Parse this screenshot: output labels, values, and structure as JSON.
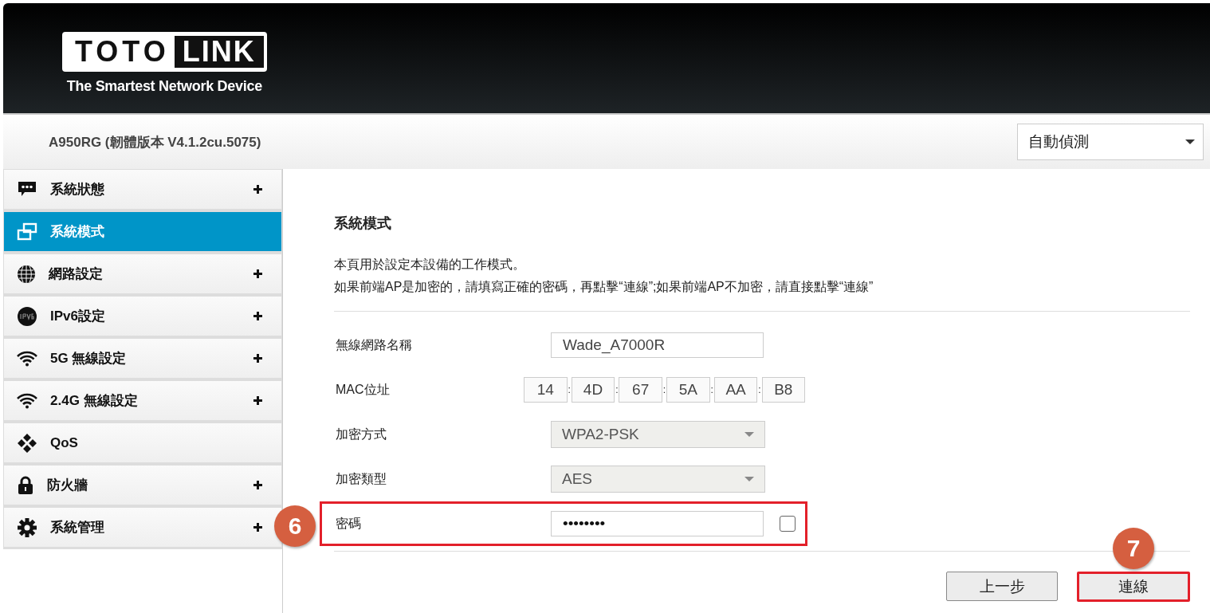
{
  "header": {
    "logo": {
      "left": "TOTO",
      "right": "LINK",
      "tagline": "The Smartest Network Device"
    }
  },
  "subheader": {
    "title": "A950RG (韌體版本 V4.1.2cu.5075)",
    "language": {
      "value": "自動偵測"
    }
  },
  "sidebar": {
    "items": [
      {
        "kind": "chat",
        "label": "系統狀態",
        "expandable": true,
        "selected": false
      },
      {
        "kind": "windows",
        "label": "系統模式",
        "expandable": false,
        "selected": true
      },
      {
        "kind": "globe",
        "label": "網路設定",
        "expandable": true,
        "selected": false
      },
      {
        "kind": "ipv6",
        "label": "IPv6設定",
        "expandable": true,
        "selected": false
      },
      {
        "kind": "wifi",
        "label": "5G 無線設定",
        "expandable": true,
        "selected": false
      },
      {
        "kind": "wifi",
        "label": "2.4G 無線設定",
        "expandable": true,
        "selected": false
      },
      {
        "kind": "qos",
        "label": "QoS",
        "expandable": false,
        "selected": false
      },
      {
        "kind": "lock",
        "label": "防火牆",
        "expandable": true,
        "selected": false
      },
      {
        "kind": "gear",
        "label": "系統管理",
        "expandable": true,
        "selected": false
      }
    ]
  },
  "content": {
    "title": "系統模式",
    "description": [
      "本頁用於設定本設備的工作模式。",
      "如果前端AP是加密的，請填寫正確的密碼，再點擊“連線”;如果前端AP不加密，請直接點擊“連線”"
    ],
    "rows": [
      {
        "kind": "text",
        "label": "無線網路名稱",
        "value": "Wade_A7000R",
        "highlighted": false
      },
      {
        "kind": "mac",
        "label": "MAC位址",
        "octets": [
          "14",
          "4D",
          "67",
          "5A",
          "AA",
          "B8"
        ],
        "separator": ":",
        "highlighted": false
      },
      {
        "kind": "select",
        "label": "加密方式",
        "value": "WPA2-PSK",
        "highlighted": false
      },
      {
        "kind": "select",
        "label": "加密類型",
        "value": "AES",
        "highlighted": false
      },
      {
        "kind": "password",
        "label": "密碼",
        "value": "••••••••",
        "show_password": false,
        "highlighted": true,
        "badge": "6"
      }
    ],
    "buttons": [
      {
        "label": "上一步",
        "highlighted": false
      },
      {
        "label": "連線",
        "highlighted": true,
        "badge": "7"
      }
    ]
  }
}
